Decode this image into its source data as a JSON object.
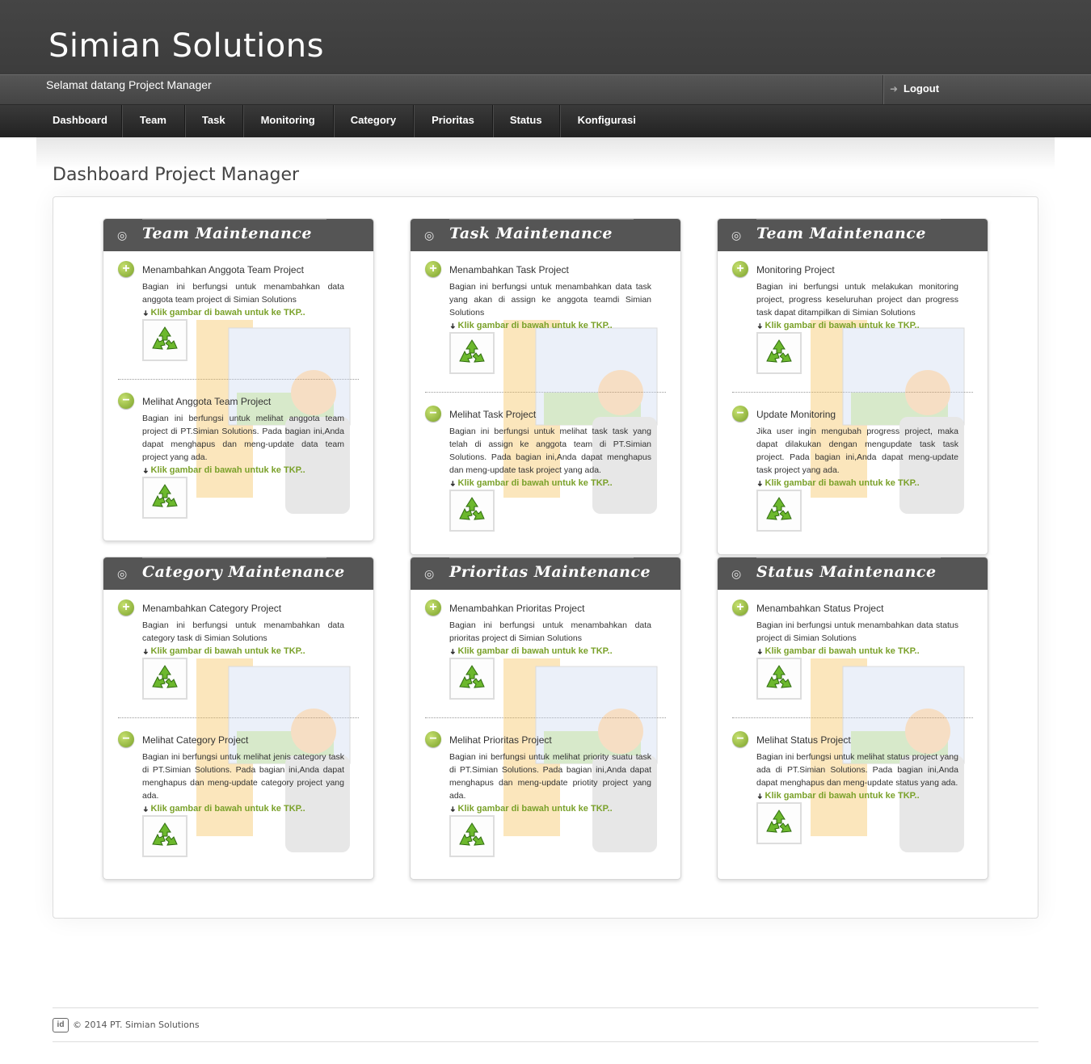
{
  "header": {
    "brand": "Simian Solutions",
    "welcome": "Selamat datang Project Manager",
    "logout_label": "Logout"
  },
  "nav": [
    {
      "label": "Dashboard"
    },
    {
      "label": "Team"
    },
    {
      "label": "Task"
    },
    {
      "label": "Monitoring"
    },
    {
      "label": "Category"
    },
    {
      "label": "Prioritas"
    },
    {
      "label": "Status"
    },
    {
      "label": "Konfigurasi"
    }
  ],
  "page_title": "Dashboard Project Manager",
  "colors": {
    "accent_green": "#7aa12a",
    "header_dark": "#3e3e3e",
    "card_head": "#555555"
  },
  "link_label": "Klik gambar di bawah untuk ke TKP..",
  "cards": [
    {
      "title": "Team Maintenance",
      "sections": [
        {
          "icon": "plus-icon",
          "title": "Menambahkan Anggota Team Project",
          "desc": "Bagian ini berfungsi untuk menambahkan data anggota team project di Simian Solutions"
        },
        {
          "icon": "minus-icon",
          "title": "Melihat Anggota Team Project",
          "desc": "Bagian ini berfungsi untuk melihat anggota team project di PT.Simian Solutions. Pada bagian ini,Anda dapat menghapus dan meng-update data team project yang ada."
        }
      ]
    },
    {
      "title": "Task Maintenance",
      "sections": [
        {
          "icon": "plus-icon",
          "title": "Menambahkan Task Project",
          "desc": "Bagian ini berfungsi untuk menambahkan data task yang akan di assign ke anggota teamdi Simian Solutions"
        },
        {
          "icon": "minus-icon",
          "title": "Melihat Task Project",
          "desc": "Bagian ini berfungsi untuk melihat task task yang telah di assign ke anggota team di PT.Simian Solutions. Pada bagian ini,Anda dapat menghapus dan meng-update task project yang ada."
        }
      ]
    },
    {
      "title": "Team Maintenance",
      "sections": [
        {
          "icon": "plus-icon",
          "title": "Monitoring Project",
          "desc": "Bagian ini berfungsi untuk melakukan monitoring project, progress keseluruhan project dan progress task dapat ditampilkan di Simian Solutions"
        },
        {
          "icon": "minus-icon",
          "title": "Update Monitoring",
          "desc": "Jika user ingin mengubah progress project, maka dapat dilakukan dengan mengupdate task task project. Pada bagian ini,Anda dapat meng-update task project yang ada."
        }
      ]
    },
    {
      "title": "Category Maintenance",
      "sections": [
        {
          "icon": "plus-icon",
          "title": "Menambahkan Category Project",
          "desc": "Bagian ini berfungsi untuk menambahkan data category task di Simian Solutions"
        },
        {
          "icon": "minus-icon",
          "title": "Melihat Category Project",
          "desc": "Bagian ini berfungsi untuk melihat jenis category task di PT.Simian Solutions. Pada bagian ini,Anda dapat menghapus dan meng-update category project yang ada."
        }
      ]
    },
    {
      "title": "Prioritas Maintenance",
      "sections": [
        {
          "icon": "plus-icon",
          "title": "Menambahkan Prioritas Project",
          "desc": "Bagian ini berfungsi untuk menambahkan data prioritas project di Simian Solutions"
        },
        {
          "icon": "minus-icon",
          "title": "Melihat Prioritas Project",
          "desc": "Bagian ini berfungsi untuk melihat priority suatu task di PT.Simian Solutions. Pada bagian ini,Anda dapat menghapus dan meng-update priotity project yang ada."
        }
      ]
    },
    {
      "title": "Status Maintenance",
      "sections": [
        {
          "icon": "plus-icon",
          "title": "Menambahkan Status Project",
          "desc": "Bagian ini berfungsi untuk menambahkan data status project di Simian Solutions"
        },
        {
          "icon": "minus-icon",
          "title": "Melihat Status Project",
          "desc": "Bagian ini berfungsi untuk melihat status project yang ada di PT.Simian Solutions. Pada bagian ini,Anda dapat menghapus dan meng-update status yang ada."
        }
      ]
    }
  ],
  "footer": {
    "logo_text": "id",
    "copyright": "© 2014 PT. Simian Solutions"
  }
}
